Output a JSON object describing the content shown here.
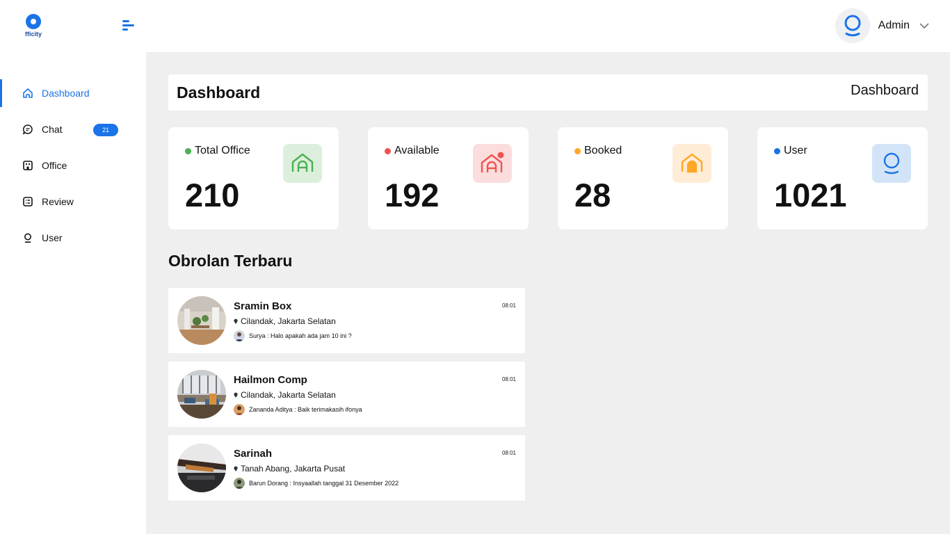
{
  "app": {
    "logo_text": "fficity"
  },
  "header": {
    "user_name": "Admin"
  },
  "sidebar": {
    "items": [
      {
        "label": "Dashboard",
        "icon": "home-icon",
        "active": true
      },
      {
        "label": "Chat",
        "icon": "chat-icon",
        "badge": "21"
      },
      {
        "label": "Office",
        "icon": "office-icon"
      },
      {
        "label": "Review",
        "icon": "review-icon"
      },
      {
        "label": "User",
        "icon": "user-icon"
      }
    ]
  },
  "page": {
    "title": "Dashboard",
    "breadcrumb": "Dashboard"
  },
  "stats": [
    {
      "label": "Total Office",
      "value": "210",
      "color": "#4caf50",
      "icon": "home-icon",
      "icon_bg": "#dcefdc"
    },
    {
      "label": "Available",
      "value": "192",
      "color": "#ef5350",
      "icon": "home-notification-icon",
      "icon_bg": "#fbdddd"
    },
    {
      "label": "Booked",
      "value": "28",
      "color": "#ffa726",
      "icon": "home-booked-icon",
      "icon_bg": "#ffecd6"
    },
    {
      "label": "User",
      "value": "1021",
      "color": "#1a73e8",
      "icon": "user-icon",
      "icon_bg": "#d3e4f8"
    }
  ],
  "recent_chats": {
    "title": "Obrolan Terbaru",
    "items": [
      {
        "name": "Sramin Box",
        "time": "08:01",
        "location": "Cilandak, Jakarta Selatan",
        "message": "Surya : Halo apakah ada jam 10 ini ?"
      },
      {
        "name": "Hailmon Comp",
        "time": "08:01",
        "location": "Cilandak, Jakarta Selatan",
        "message": "Zananda Aditya : Baik terimakasih ifonya"
      },
      {
        "name": "Sarinah",
        "time": "08:01",
        "location": "Tanah Abang, Jakarta Pusat",
        "message": "Barun Dorang :  Insyaallah tanggal 31 Desember 2022"
      }
    ]
  },
  "colors": {
    "accent": "#1a73e8",
    "background": "#efefef"
  }
}
